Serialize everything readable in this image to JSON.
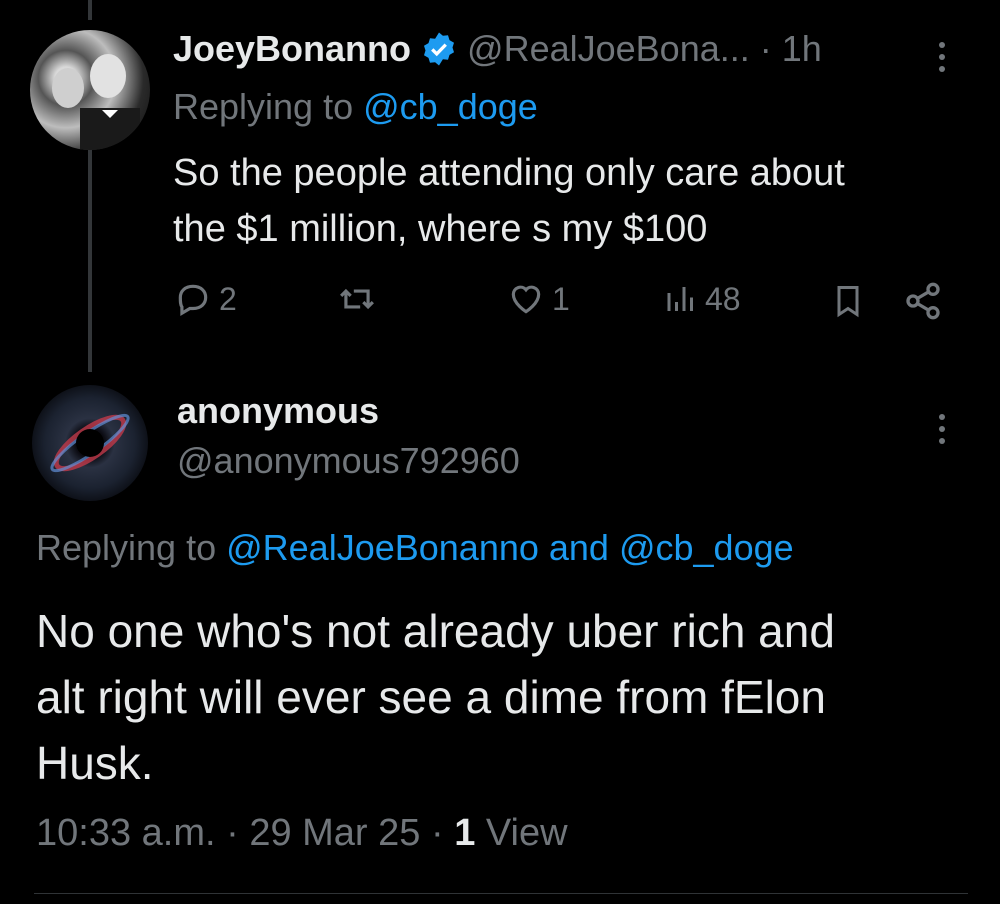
{
  "tweet1": {
    "name": "JoeyBonanno",
    "handle": "@RealJoeBona...",
    "time": "· 1h",
    "replying_prefix": "Replying to ",
    "replying_to": "@cb_doge",
    "text_line1": "So the people attending only care about",
    "text_line2": "the $1 million, where s my $100",
    "actions": {
      "reply_count": "2",
      "like_count": "1",
      "view_count": "48"
    },
    "icons": [
      "reply-icon",
      "retweet-icon",
      "like-icon",
      "views-icon",
      "bookmark-icon",
      "share-icon",
      "more-icon",
      "verified-badge-icon"
    ]
  },
  "tweet2": {
    "name": "anonymous",
    "handle": "@anonymous792960",
    "replying_prefix": "Replying to ",
    "replying_to_1": "@RealJoeBonanno",
    "replying_and": " and ",
    "replying_to_2": "@cb_doge",
    "text_line1": "No one who's not already uber rich and",
    "text_line2": "alt right will ever see a dime from fElon",
    "text_line3": "Husk.",
    "timestamp": "10:33 a.m. · 29 Mar 25 · ",
    "view_number": "1",
    "view_label": " View"
  },
  "colors": {
    "background": "#000000",
    "text": "#e7e9ea",
    "muted": "#71767b",
    "link": "#1d9bf0"
  }
}
